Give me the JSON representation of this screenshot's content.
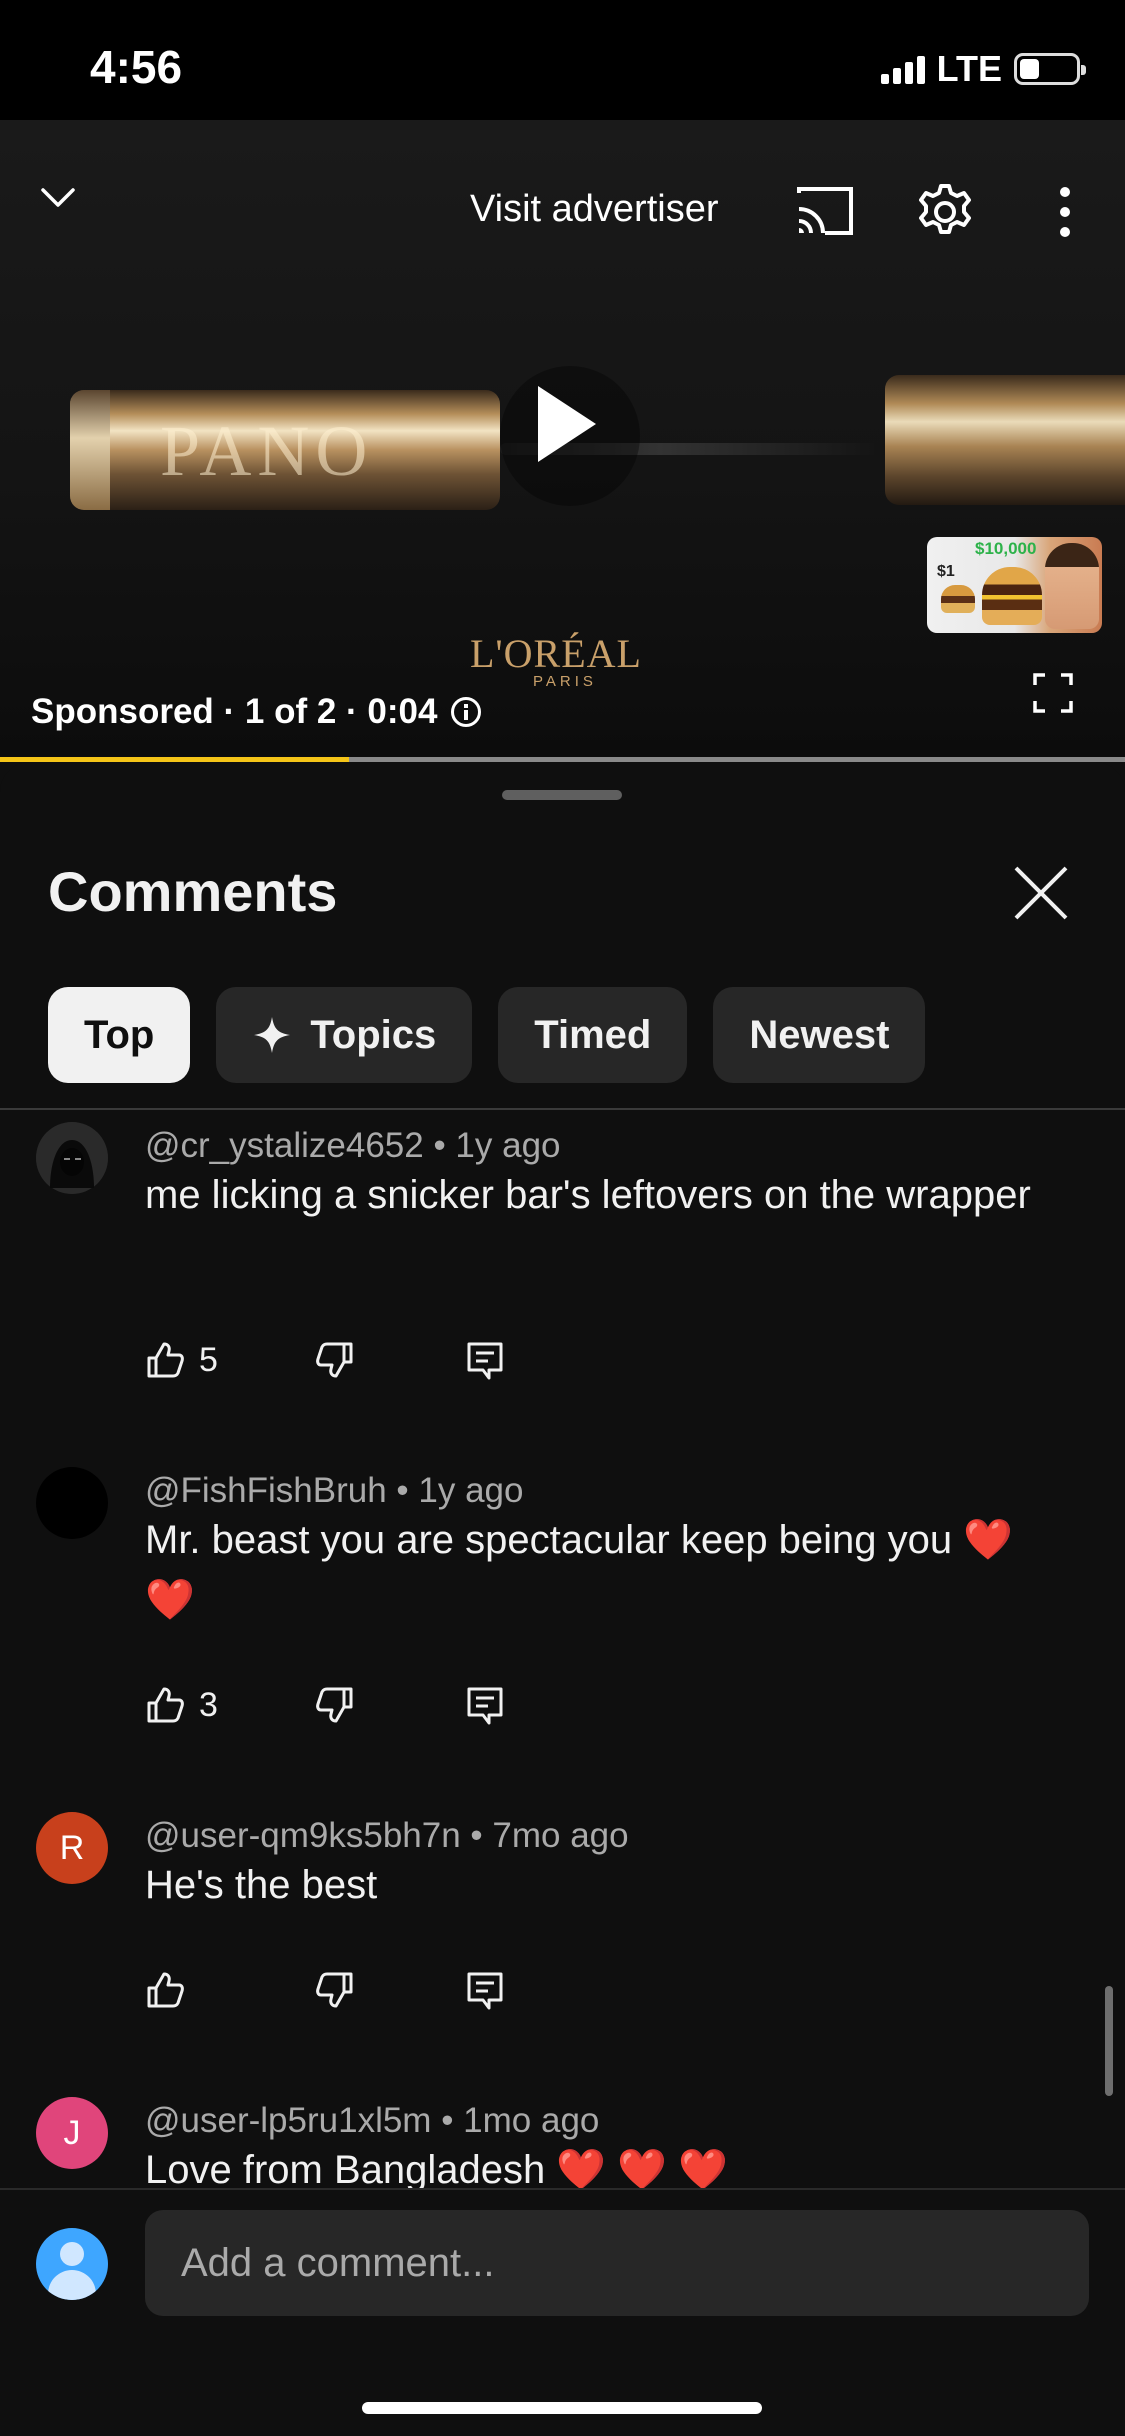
{
  "status": {
    "time": "4:56",
    "network": "LTE",
    "battery_fraction": 0.35
  },
  "video": {
    "visit_advertiser": "Visit advertiser",
    "product_lettering": "PANO",
    "brand": "L'ORÉAL",
    "brand_sub": "PARIS",
    "sponsored_text": "Sponsored · 1 of 2 · 0:04",
    "progress_fraction": 0.31,
    "thumbnail": {
      "money": "$10,000",
      "price": "$1"
    },
    "progress_color": "#f5c518"
  },
  "comments_sheet": {
    "title": "Comments",
    "chips": [
      {
        "label": "Top",
        "active": true
      },
      {
        "label": "Topics",
        "active": false,
        "icon": "sparkle-icon"
      },
      {
        "label": "Timed",
        "active": false
      },
      {
        "label": "Newest",
        "active": false
      }
    ],
    "comments": [
      {
        "handle": "@cr_ystalize4652",
        "age": "1y ago",
        "text": "me licking a snicker bar's leftovers on the wrapper",
        "likes": "5",
        "avatar_initial": "",
        "avatar_color": "#1e1e1e"
      },
      {
        "handle": "@FishFishBruh",
        "age": "1y ago",
        "text": "Mr. beast you are spectacular keep being you ❤️❤️",
        "likes": "3",
        "avatar_initial": "",
        "avatar_color": "#000000"
      },
      {
        "handle": "@user-qm9ks5bh7n",
        "age": "7mo ago",
        "text": "He's the best",
        "likes": "",
        "avatar_initial": "R",
        "avatar_color": "#c8401c"
      },
      {
        "handle": "@user-lp5ru1xl5m",
        "age": "1mo ago",
        "text": "Love from Bangladesh ❤️ ❤️ ❤️",
        "likes": "",
        "avatar_initial": "J",
        "avatar_color": "#e0457b"
      }
    ]
  },
  "composer": {
    "placeholder": "Add a comment..."
  }
}
